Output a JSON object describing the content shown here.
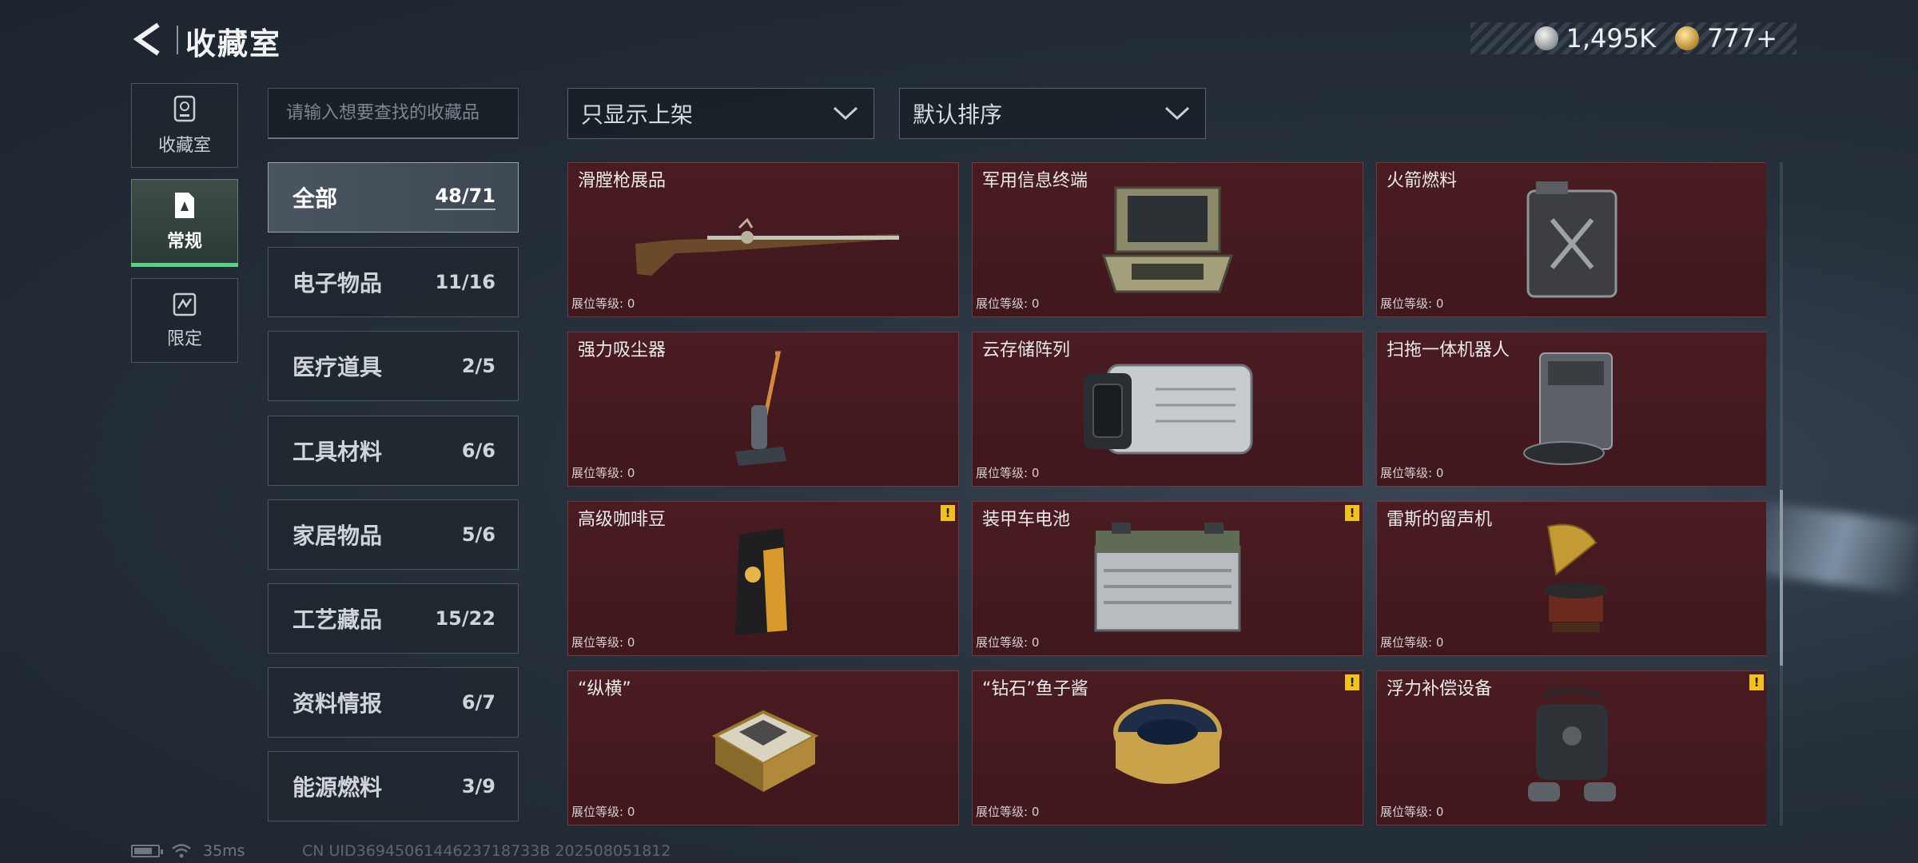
{
  "header": {
    "title": "收藏室"
  },
  "currency": {
    "silver": "1,495K",
    "gold": "777+"
  },
  "mode_tabs": [
    {
      "label": "收藏室",
      "icon": "trophy-icon"
    },
    {
      "label": "常规",
      "icon": "document-icon"
    },
    {
      "label": "限定",
      "icon": "limited-icon"
    }
  ],
  "search": {
    "placeholder": "请输入想要查找的收藏品"
  },
  "categories": [
    {
      "name": "全部",
      "count": "48/71"
    },
    {
      "name": "电子物品",
      "count": "11/16"
    },
    {
      "name": "医疗道具",
      "count": "2/5"
    },
    {
      "name": "工具材料",
      "count": "6/6"
    },
    {
      "name": "家居物品",
      "count": "5/6"
    },
    {
      "name": "工艺藏品",
      "count": "15/22"
    },
    {
      "name": "资料情报",
      "count": "6/7"
    },
    {
      "name": "能源燃料",
      "count": "3/9"
    }
  ],
  "filters": {
    "display": "只显示上架",
    "sort": "默认排序"
  },
  "items": [
    {
      "name": "滑膛枪展品",
      "level_label": "展位等级",
      "level": "0"
    },
    {
      "name": "军用信息终端",
      "level_label": "展位等级",
      "level": "0"
    },
    {
      "name": "火箭燃料",
      "level_label": "展位等级",
      "level": "0"
    },
    {
      "name": "强力吸尘器",
      "level_label": "展位等级",
      "level": "0"
    },
    {
      "name": "云存储阵列",
      "level_label": "展位等级",
      "level": "0"
    },
    {
      "name": "扫拖一体机器人",
      "level_label": "展位等级",
      "level": "0"
    },
    {
      "name": "高级咖啡豆",
      "level_label": "展位等级",
      "level": "0",
      "warning": "!"
    },
    {
      "name": "装甲车电池",
      "level_label": "展位等级",
      "level": "0",
      "warning": "!"
    },
    {
      "name": "雷斯的留声机",
      "level_label": "展位等级",
      "level": "0"
    },
    {
      "name": "“纵横”",
      "level_label": "展位等级",
      "level": "0"
    },
    {
      "name": "“钻石”鱼子酱",
      "level_label": "展位等级",
      "level": "0",
      "warning": "!"
    },
    {
      "name": "浮力补偿设备",
      "level_label": "展位等级",
      "level": "0",
      "warning": "!"
    }
  ],
  "status": {
    "ping": "35ms",
    "uid": "CN UID3694506144623718733B 202508051812"
  }
}
